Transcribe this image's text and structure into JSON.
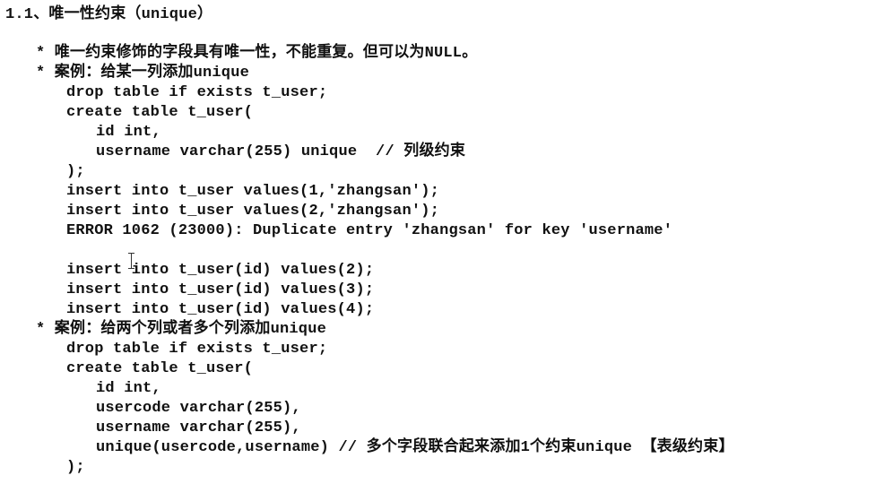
{
  "section": {
    "heading": "1.1、唯一性约束（unique）"
  },
  "content": {
    "bullet1": "* 唯一约束修饰的字段具有唯一性，不能重复。但可以为NULL。",
    "bullet2": "* 案例：给某一列添加unique",
    "example1": [
      "drop table if exists t_user;",
      "create table t_user(",
      "id int,",
      "username varchar(255) unique  // 列级约束",
      ");",
      "insert into t_user values(1,'zhangsan');",
      "insert into t_user values(2,'zhangsan');",
      "ERROR 1062 (23000): Duplicate entry 'zhangsan' for key 'username'",
      "insert into t_user(id) values(2);",
      "insert into t_user(id) values(3);",
      "insert into t_user(id) values(4);"
    ],
    "bullet3": "* 案例：给两个列或者多个列添加unique",
    "example2": [
      "drop table if exists t_user;",
      "create table t_user(",
      "id int,",
      "usercode varchar(255),",
      "username varchar(255),",
      "unique(usercode,username) // 多个字段联合起来添加1个约束unique 【表级约束】",
      ");"
    ]
  },
  "cursor": {
    "icon": "text-cursor-icon"
  }
}
